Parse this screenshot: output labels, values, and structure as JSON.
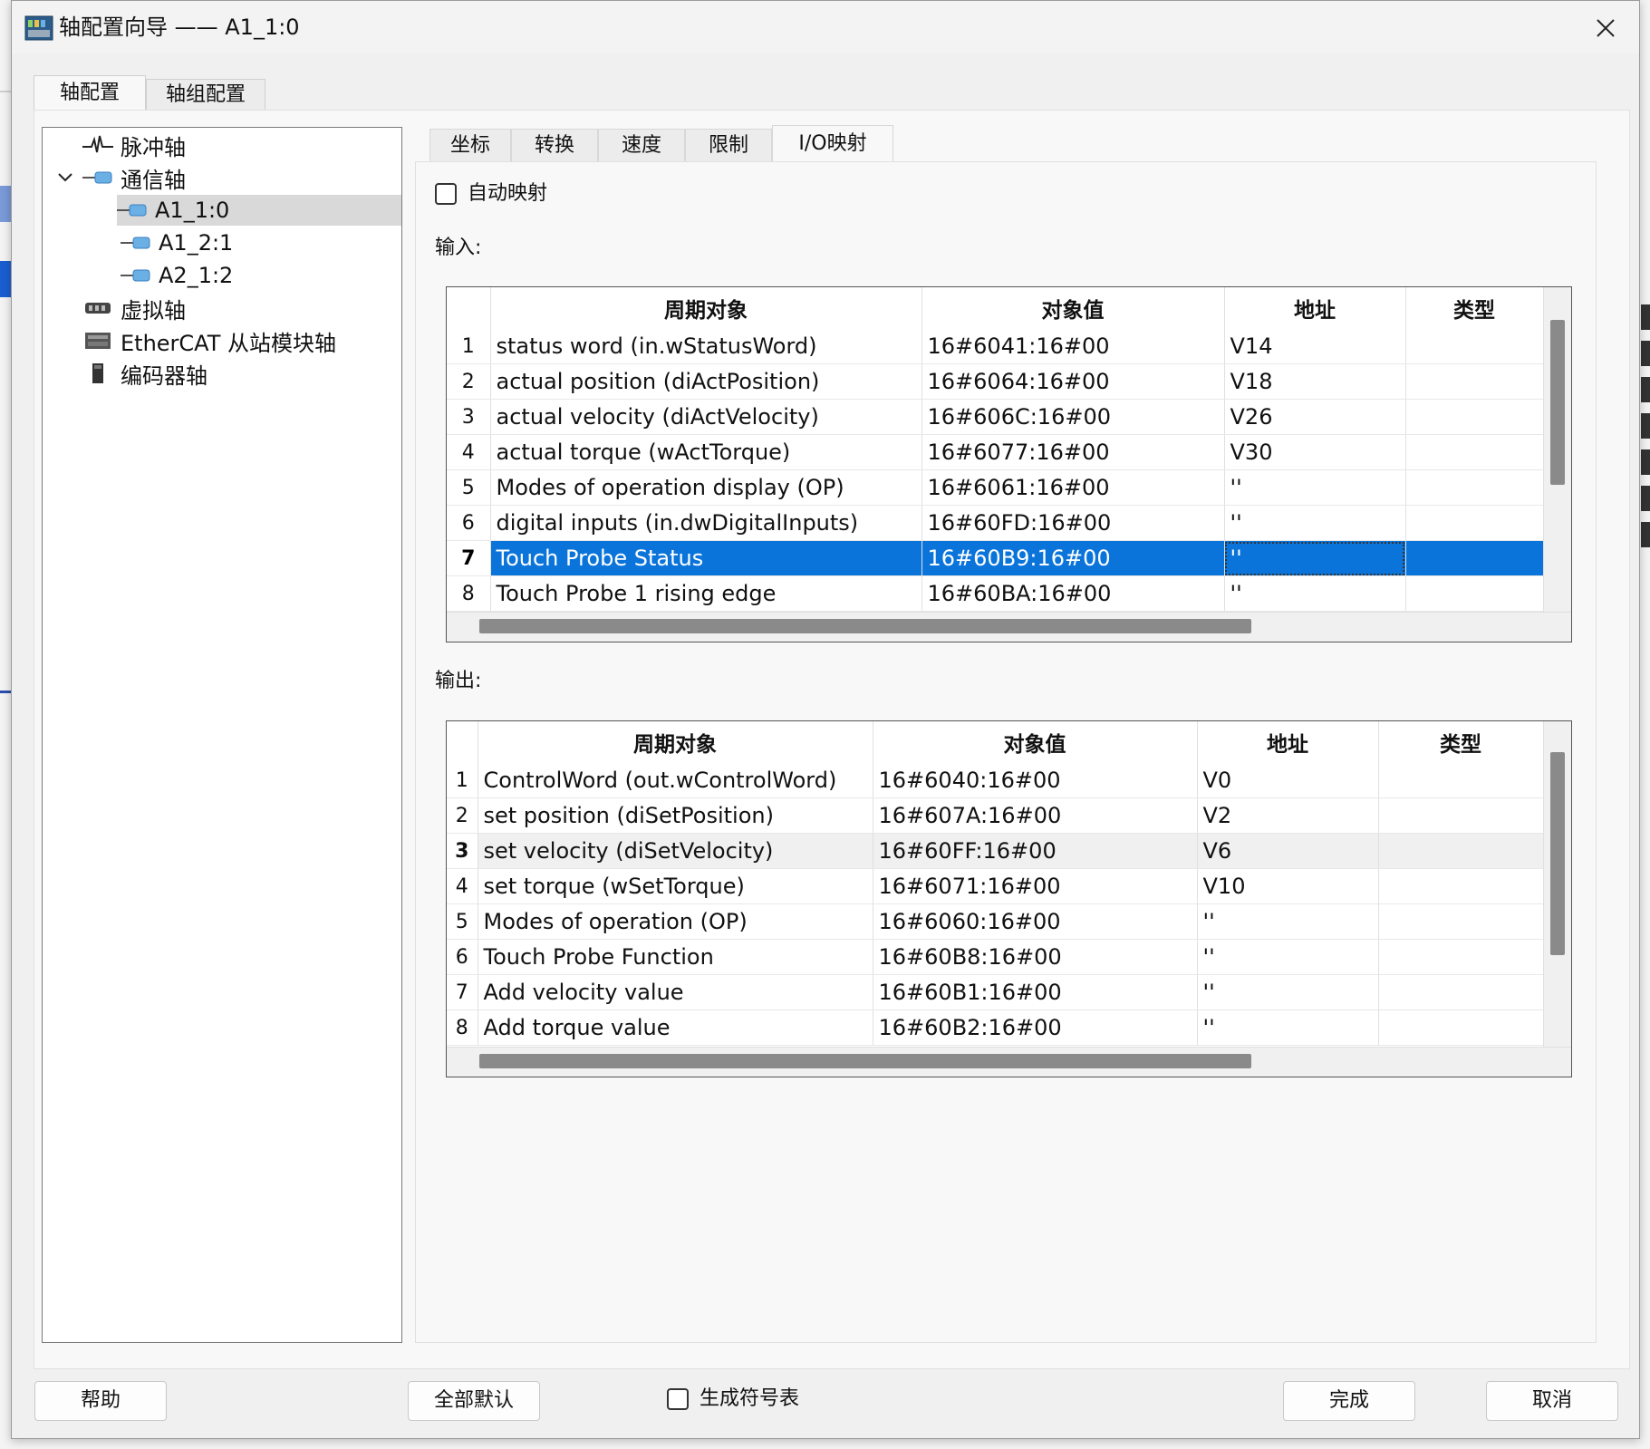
{
  "window": {
    "title": "轴配置向导 —— A1_1:0"
  },
  "top_tabs": [
    "轴配置",
    "轴组配置"
  ],
  "tree": {
    "items": [
      {
        "label": "脉冲轴",
        "icon": "pulse-axis-icon",
        "level": 0
      },
      {
        "label": "通信轴",
        "icon": "comm-axis-icon",
        "level": 0,
        "expanded": true
      },
      {
        "label": "A1_1:0",
        "icon": "axis-node-icon",
        "level": 1,
        "selected": true
      },
      {
        "label": "A1_2:1",
        "icon": "axis-node-icon",
        "level": 1
      },
      {
        "label": "A2_1:2",
        "icon": "axis-node-icon",
        "level": 1
      },
      {
        "label": "虚拟轴",
        "icon": "virtual-axis-icon",
        "level": 0
      },
      {
        "label": "EtherCAT 从站模块轴",
        "icon": "ethercat-module-icon",
        "level": 0
      },
      {
        "label": "编码器轴",
        "icon": "encoder-axis-icon",
        "level": 0
      }
    ]
  },
  "sub_tabs": [
    "坐标",
    "转换",
    "速度",
    "限制",
    "I/O映射"
  ],
  "auto_map": {
    "label": "自动映射",
    "checked": false
  },
  "input": {
    "label": "输入:",
    "columns": [
      "周期对象",
      "对象值",
      "地址",
      "类型"
    ],
    "rows": [
      {
        "n": "1",
        "obj": "status word (in.wStatusWord)",
        "val": "16#6041:16#00",
        "addr": "V14",
        "type": ""
      },
      {
        "n": "2",
        "obj": "actual position (diActPosition)",
        "val": "16#6064:16#00",
        "addr": "V18",
        "type": ""
      },
      {
        "n": "3",
        "obj": "actual velocity (diActVelocity)",
        "val": "16#606C:16#00",
        "addr": "V26",
        "type": ""
      },
      {
        "n": "4",
        "obj": "actual torque (wActTorque)",
        "val": "16#6077:16#00",
        "addr": "V30",
        "type": ""
      },
      {
        "n": "5",
        "obj": "Modes of operation display (OP)",
        "val": "16#6061:16#00",
        "addr": "''",
        "type": ""
      },
      {
        "n": "6",
        "obj": "digital inputs (in.dwDigitalInputs)",
        "val": "16#60FD:16#00",
        "addr": "''",
        "type": ""
      },
      {
        "n": "7",
        "obj": "Touch Probe Status",
        "val": "16#60B9:16#00",
        "addr": "''",
        "type": ""
      },
      {
        "n": "8",
        "obj": "Touch Probe 1 rising edge",
        "val": "16#60BA:16#00",
        "addr": "''",
        "type": ""
      }
    ],
    "selected_row": 7
  },
  "output": {
    "label": "输出:",
    "columns": [
      "周期对象",
      "对象值",
      "地址",
      "类型"
    ],
    "rows": [
      {
        "n": "1",
        "obj": "ControlWord (out.wControlWord)",
        "val": "16#6040:16#00",
        "addr": "V0",
        "type": ""
      },
      {
        "n": "2",
        "obj": "set position (diSetPosition)",
        "val": "16#607A:16#00",
        "addr": "V2",
        "type": ""
      },
      {
        "n": "3",
        "obj": "set velocity (diSetVelocity)",
        "val": "16#60FF:16#00",
        "addr": "V6",
        "type": ""
      },
      {
        "n": "4",
        "obj": "set torque (wSetTorque)",
        "val": "16#6071:16#00",
        "addr": "V10",
        "type": ""
      },
      {
        "n": "5",
        "obj": "Modes of operation (OP)",
        "val": "16#6060:16#00",
        "addr": "''",
        "type": ""
      },
      {
        "n": "6",
        "obj": "Touch Probe Function",
        "val": "16#60B8:16#00",
        "addr": "''",
        "type": ""
      },
      {
        "n": "7",
        "obj": "Add velocity value",
        "val": "16#60B1:16#00",
        "addr": "''",
        "type": ""
      },
      {
        "n": "8",
        "obj": "Add torque value",
        "val": "16#60B2:16#00",
        "addr": "''",
        "type": ""
      }
    ],
    "hovered_row": 3
  },
  "footer": {
    "help": "帮助",
    "defaults": "全部默认",
    "gen_symbols": {
      "label": "生成符号表",
      "checked": false
    },
    "finish": "完成",
    "cancel": "取消"
  },
  "colors": {
    "selection": "#0a74da"
  }
}
